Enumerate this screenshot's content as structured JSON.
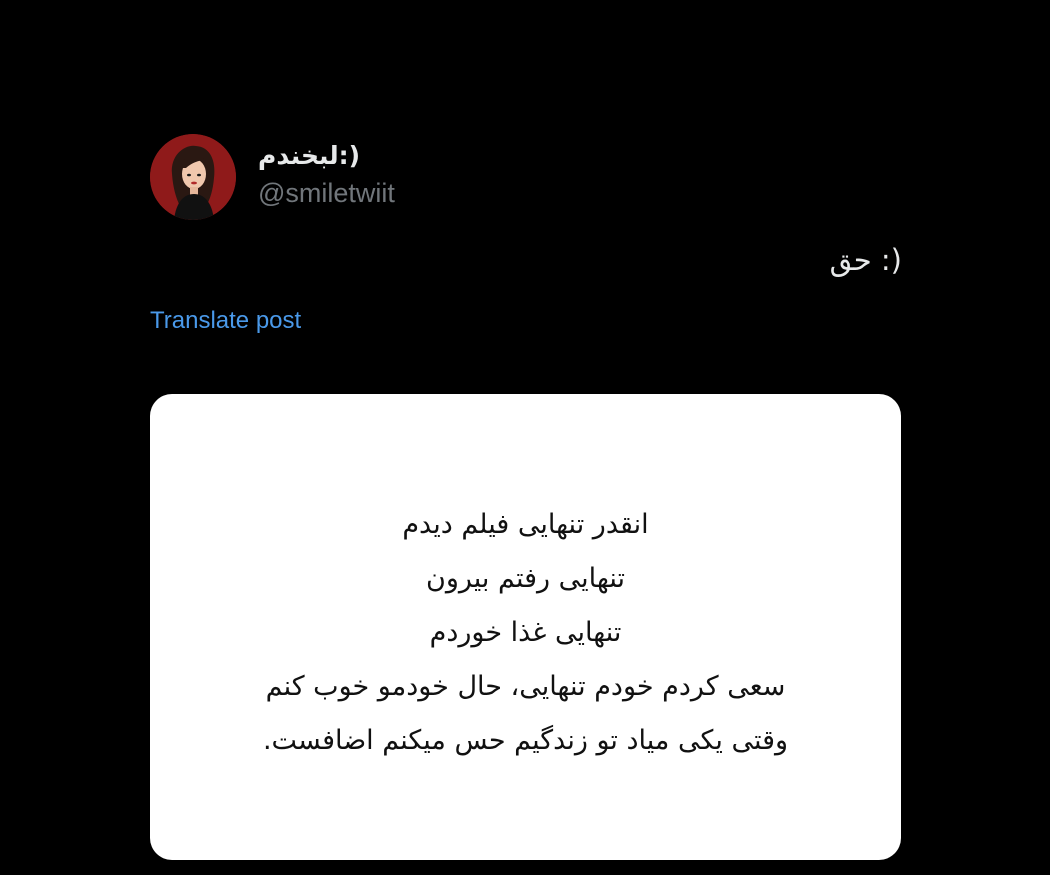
{
  "author": {
    "display_name": "لبخندم:)",
    "handle": "@smiletwiit",
    "avatar_icon": "profile-avatar"
  },
  "post": {
    "text": "حق :)",
    "translate_label": "Translate post"
  },
  "media": {
    "lines": [
      "انقدر تنهایی فیلم دیدم",
      "تنهایی رفتم بیرون",
      "تنهایی غذا خوردم",
      "سعی کردم خودم تنهایی، حال خودمو خوب کنم",
      "وقتی یکی میاد تو زندگیم حس میکنم اضافست."
    ]
  },
  "colors": {
    "background": "#000000",
    "primary_text": "#e7e9ea",
    "secondary_text": "#71767b",
    "link": "#4a99e9",
    "card": "#ffffff",
    "card_text": "#111111"
  }
}
